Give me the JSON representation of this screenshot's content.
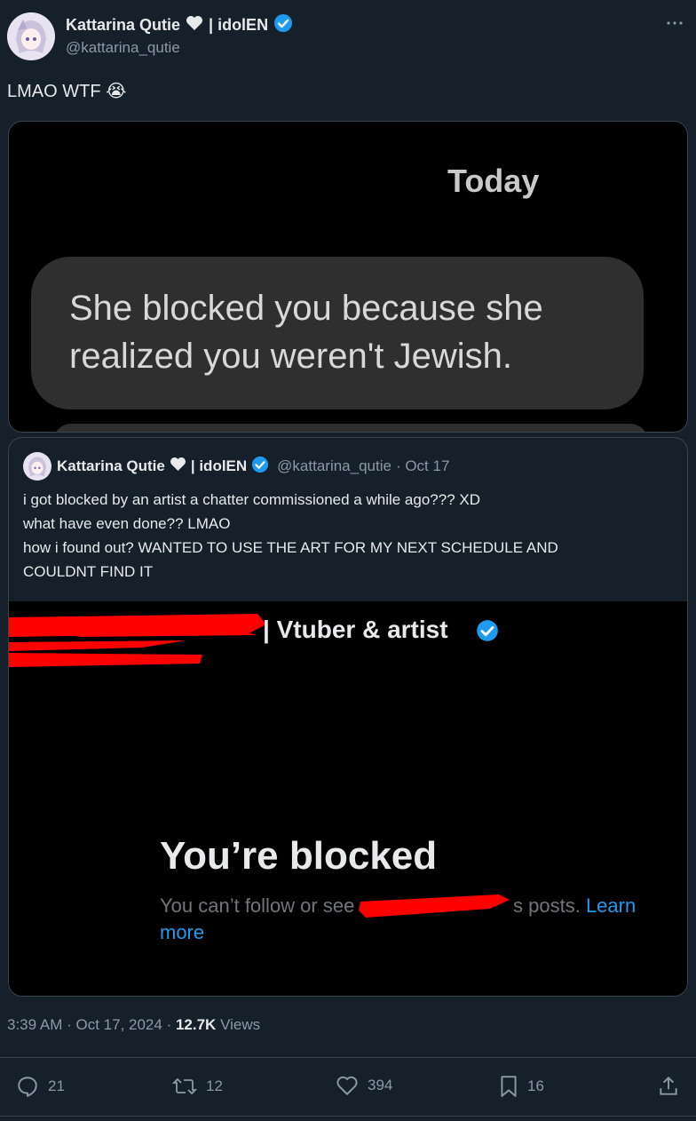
{
  "tweet": {
    "author": {
      "display_name": "Kattarina Qutie",
      "name_suffix": "| idolEN",
      "handle": "@kattarina_qutie"
    },
    "text": "LMAO WTF",
    "emoji": "😭",
    "image": {
      "day_label": "Today",
      "bubble_line1": "She blocked you because she",
      "bubble_line2": "realized you weren't Jewish."
    },
    "meta": {
      "time": "3:39 AM",
      "date": "Oct 17, 2024",
      "views_count": "12.7K",
      "views_label": "Views"
    },
    "actions": {
      "replies": "21",
      "reposts": "12",
      "likes": "394",
      "bookmarks": "16"
    }
  },
  "quote": {
    "display_name": "Kattarina Qutie",
    "name_suffix": "| idolEN",
    "handle": "@kattarina_qutie",
    "date": "· Oct 17",
    "lines": [
      "i got blocked by an artist a chatter commissioned a while ago??? XD",
      "what have even done?? LMAO",
      "how i found out? WANTED TO USE THE ART FOR MY NEXT SCHEDULE AND",
      "COULDNT FIND IT"
    ],
    "image": {
      "profile_suffix": "| Vtuber & artist",
      "blocked_title": "You’re blocked",
      "blocked_text_prefix": "You can’t follow or see",
      "blocked_text_suffix": "s posts.",
      "learn_more_1": "Learn",
      "learn_more_2": "more"
    }
  },
  "colors": {
    "background": "#15202b",
    "accent": "#1d9bf0",
    "muted": "#8b98a5",
    "redaction": "#ff0000"
  }
}
